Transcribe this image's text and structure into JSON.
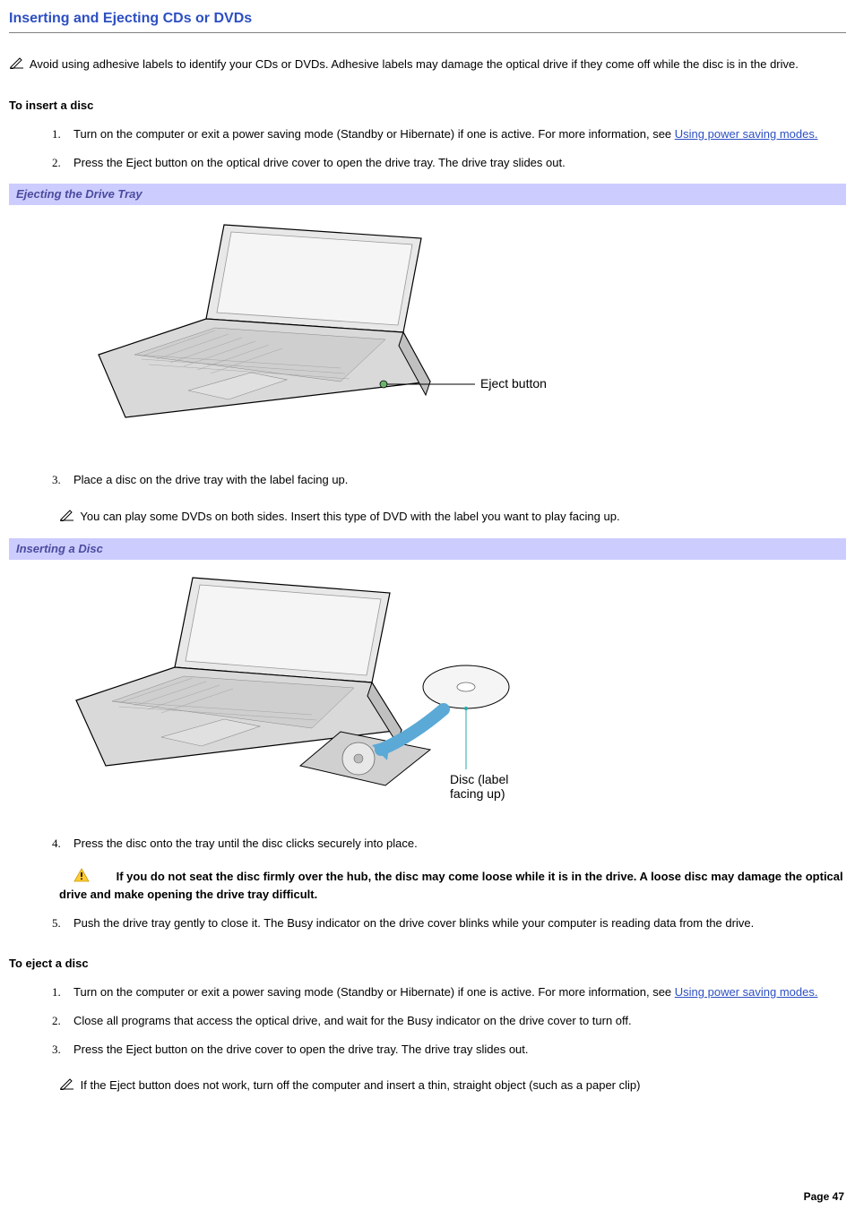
{
  "heading": "Inserting and Ejecting CDs or DVDs",
  "top_note": "Avoid using adhesive labels to identify your CDs or DVDs. Adhesive labels may damage the optical drive if they come off while the disc is in the drive.",
  "insert": {
    "title": "To insert a disc",
    "step1_a": "Turn on the computer or exit a power saving mode (Standby or Hibernate) if one is active. For more information, see ",
    "step1_link": "Using power saving modes.",
    "step2": "Press the Eject button on the optical drive cover to open the drive tray. The drive tray slides out.",
    "fig1_caption": "Ejecting the Drive Tray",
    "fig1_label": "Eject button",
    "step3": "Place a disc on the drive tray with the label facing up.",
    "step3_note": "You can play some DVDs on both sides. Insert this type of DVD with the label you want to play facing up.",
    "fig2_caption": "Inserting a Disc",
    "fig2_label1": "Disc (label",
    "fig2_label2": "facing up)",
    "step4": "Press the disc onto the tray until the disc clicks securely into place.",
    "step4_warning": "If you do not seat the disc firmly over the hub, the disc may come loose while it is in the drive. A loose disc may damage the optical drive and make opening the drive tray difficult.",
    "step5": "Push the drive tray gently to close it. The Busy indicator on the drive cover blinks while your computer is reading data from the drive."
  },
  "eject": {
    "title": "To eject a disc",
    "step1_a": "Turn on the computer or exit a power saving mode (Standby or Hibernate) if one is active. For more information, see ",
    "step1_link": "Using power saving modes.",
    "step2": "Close all programs that access the optical drive, and wait for the Busy indicator on the drive cover to turn off.",
    "step3": "Press the Eject button on the drive cover to open the drive tray. The drive tray slides out.",
    "step3_note": "If the Eject button does not work, turn off the computer and insert a thin, straight object (such as a paper clip)"
  },
  "page_number": "Page 47"
}
